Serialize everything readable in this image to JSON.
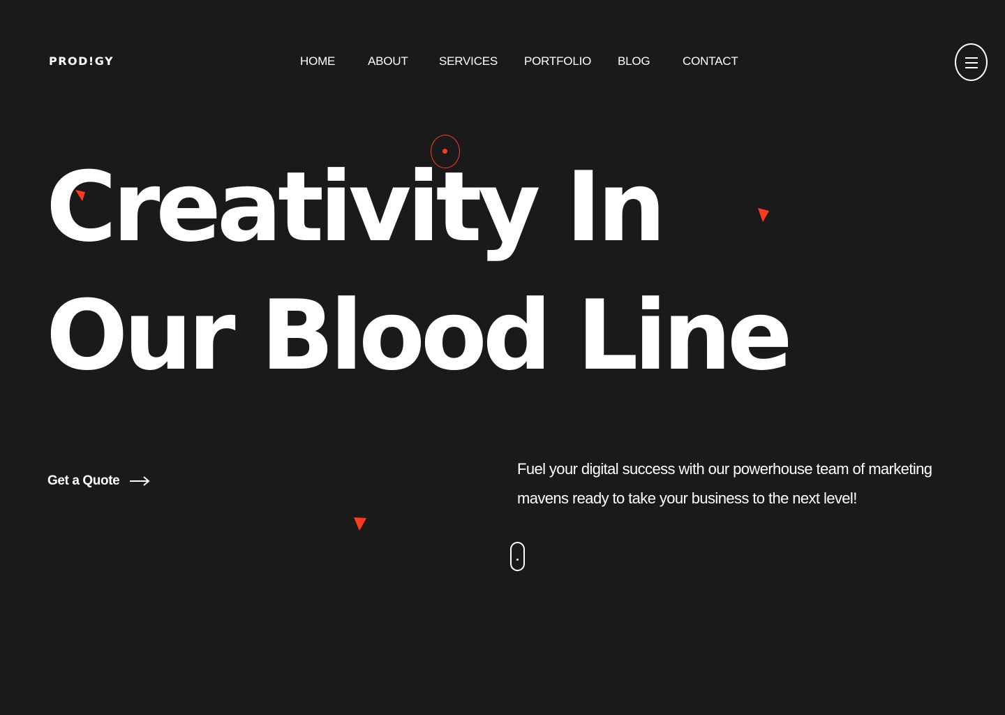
{
  "brand": {
    "logo_text": "PROD!GY"
  },
  "nav": {
    "items": [
      {
        "label": "HOME"
      },
      {
        "label": "ABOUT"
      },
      {
        "label": "SERVICES"
      },
      {
        "label": "PORTFOLIO"
      },
      {
        "label": "BLOG"
      },
      {
        "label": "CONTACT"
      }
    ]
  },
  "menu": {
    "icon": "hamburger-icon"
  },
  "hero": {
    "line_1": "Creativity In",
    "line_2": "Our Blood Line",
    "cta_label": "Get a Quote",
    "cta_icon": "arrow-right-icon",
    "tagline": "Fuel your digital success with our powerhouse team of marketing mavens ready to take your business to the next level!"
  },
  "colors": {
    "background": "#1a1a1b",
    "text": "#ffffff",
    "accent": "#ff3b1f"
  }
}
